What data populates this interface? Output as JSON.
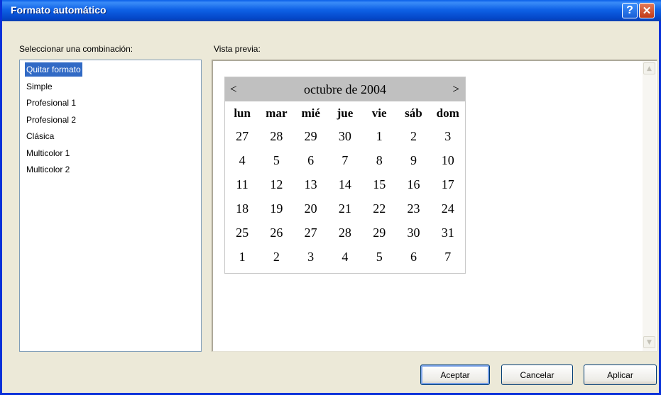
{
  "window": {
    "title": "Formato automático",
    "help_glyph": "?",
    "close_glyph": "✕"
  },
  "combo_label": "Seleccionar una combinación:",
  "preview_label": "Vista previa:",
  "schemes": [
    {
      "label": "Quitar formato",
      "selected": true
    },
    {
      "label": "Simple",
      "selected": false
    },
    {
      "label": "Profesional 1",
      "selected": false
    },
    {
      "label": "Profesional 2",
      "selected": false
    },
    {
      "label": "Clásica",
      "selected": false
    },
    {
      "label": "Multicolor 1",
      "selected": false
    },
    {
      "label": "Multicolor 2",
      "selected": false
    }
  ],
  "calendar": {
    "prev": "<",
    "next": ">",
    "title": "octubre de 2004",
    "header_bg": "#c0c0c0",
    "days_of_week": [
      "lun",
      "mar",
      "mié",
      "jue",
      "vie",
      "sáb",
      "dom"
    ],
    "weeks": [
      [
        "27",
        "28",
        "29",
        "30",
        "1",
        "2",
        "3"
      ],
      [
        "4",
        "5",
        "6",
        "7",
        "8",
        "9",
        "10"
      ],
      [
        "11",
        "12",
        "13",
        "14",
        "15",
        "16",
        "17"
      ],
      [
        "18",
        "19",
        "20",
        "21",
        "22",
        "23",
        "24"
      ],
      [
        "25",
        "26",
        "27",
        "28",
        "29",
        "30",
        "31"
      ],
      [
        "1",
        "2",
        "3",
        "4",
        "5",
        "6",
        "7"
      ]
    ]
  },
  "buttons": {
    "ok": "Aceptar",
    "cancel": "Cancelar",
    "apply": "Aplicar"
  },
  "scroll_icons": {
    "up": "▲",
    "down": "▼"
  },
  "colors": {
    "selection": "#316ac5",
    "titlebar": "#0a5fe8"
  }
}
